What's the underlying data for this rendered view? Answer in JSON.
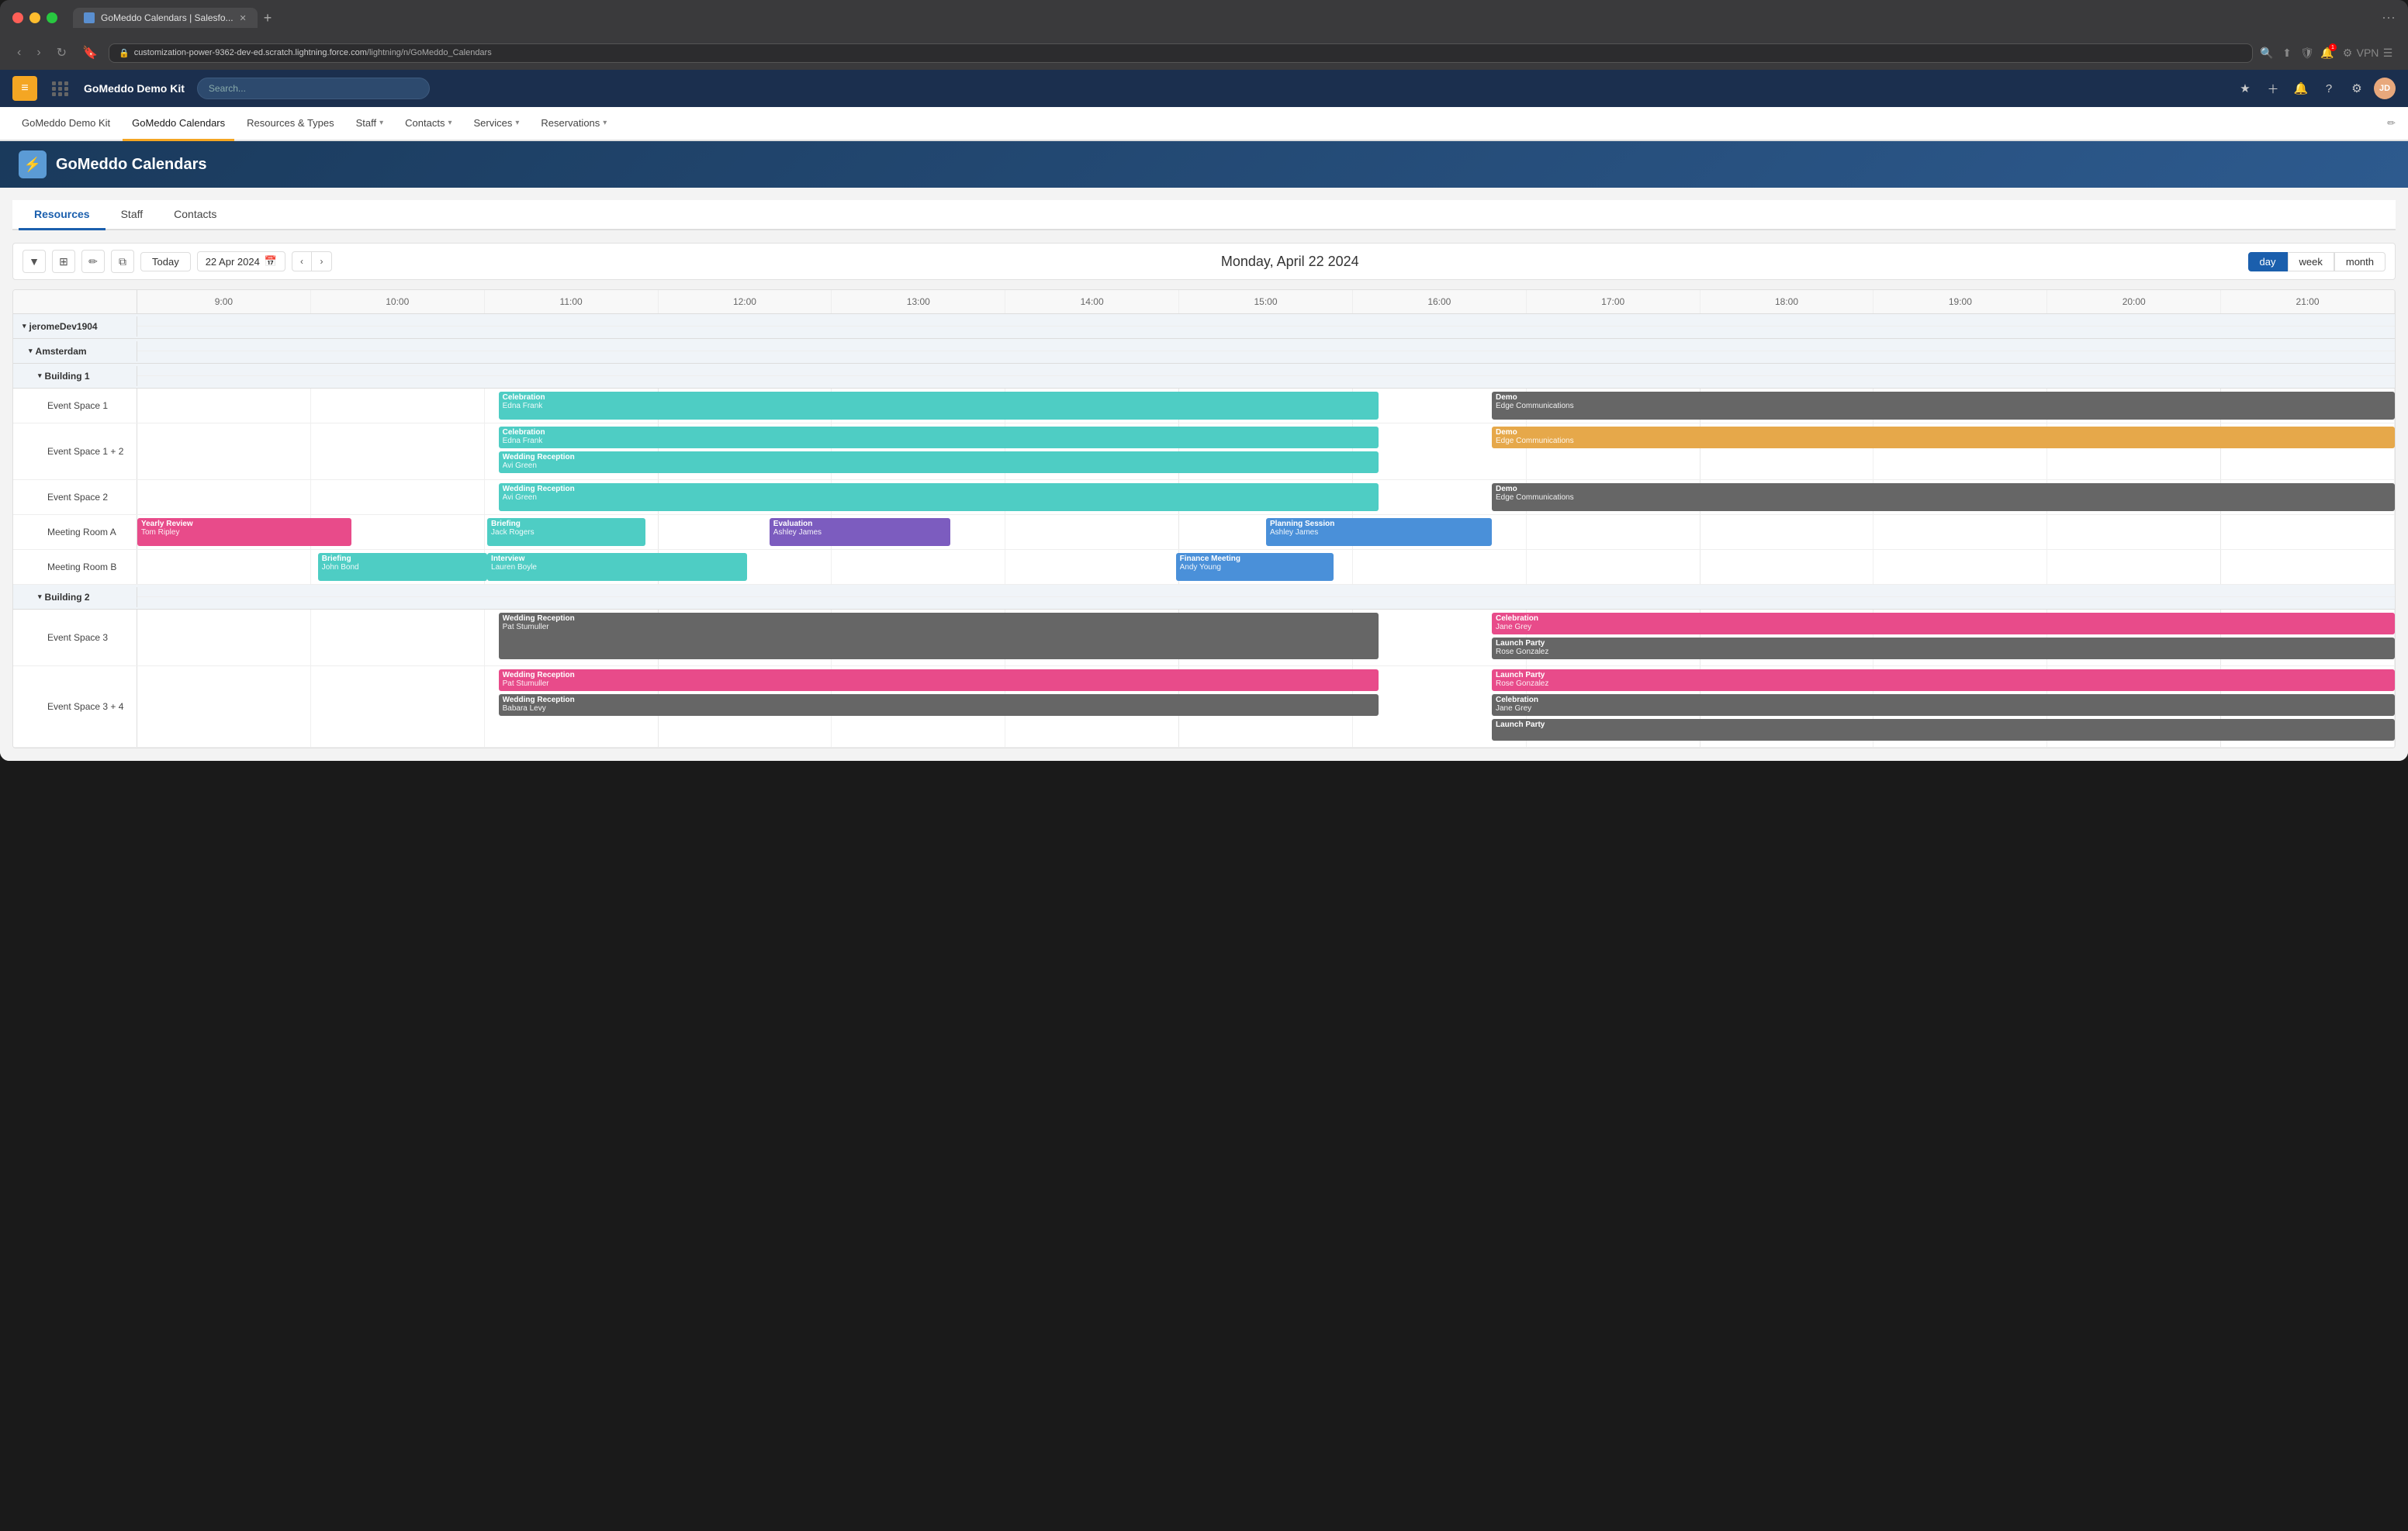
{
  "browser": {
    "tab_title": "GoMeddo Calendars | Salesfo...",
    "url_prefix": "customization-power-9362-dev-ed.scratch.lightning.force.com",
    "url_path": "/lightning/n/GoMeddo_Calendars",
    "new_tab_label": "+",
    "back_btn": "‹",
    "forward_btn": "›",
    "reload_btn": "↻"
  },
  "sf": {
    "app_name": "GoMeddo Demo Kit",
    "search_placeholder": "Search...",
    "nav_items": [
      {
        "label": "GoMeddo Demo Kit",
        "active": false
      },
      {
        "label": "GoMeddo Calendars",
        "active": true
      },
      {
        "label": "Resources & Types",
        "active": false
      },
      {
        "label": "Staff",
        "active": false,
        "dropdown": true
      },
      {
        "label": "Contacts",
        "active": false,
        "dropdown": true
      },
      {
        "label": "Services",
        "active": false,
        "dropdown": true
      },
      {
        "label": "Reservations",
        "active": false,
        "dropdown": true
      }
    ],
    "page_title": "GoMeddo Calendars"
  },
  "calendar": {
    "tabs": [
      "Resources",
      "Staff",
      "Contacts"
    ],
    "active_tab": "Resources",
    "today_label": "Today",
    "date_value": "22 Apr 2024",
    "center_date": "Monday, April 22 2024",
    "view_buttons": [
      "day",
      "week",
      "month"
    ],
    "active_view": "day",
    "time_slots": [
      "9:00",
      "10:00",
      "11:00",
      "12:00",
      "13:00",
      "14:00",
      "15:00",
      "16:00",
      "17:00",
      "18:00",
      "19:00",
      "20:00",
      "21:00"
    ],
    "groups": [
      {
        "name": "jeromeDev1904",
        "level": 0,
        "collapsed": false,
        "children": [
          {
            "name": "Amsterdam",
            "level": 1,
            "collapsed": false,
            "children": [
              {
                "name": "Building 1",
                "level": 2,
                "collapsed": false,
                "resources": [
                  {
                    "name": "Event Space 1",
                    "events": [
                      {
                        "title": "Celebration",
                        "sub": "Edna Frank",
                        "color": "teal",
                        "start_pct": 16.67,
                        "width_pct": 40,
                        "top_offset": 0
                      },
                      {
                        "title": "Demo",
                        "sub": "Edge Communications",
                        "color": "gray",
                        "start_pct": 59,
                        "width_pct": 41,
                        "top_offset": 0
                      }
                    ]
                  },
                  {
                    "name": "Event Space 1 + 2",
                    "events": [
                      {
                        "title": "Celebration",
                        "sub": "Edna Frank",
                        "color": "teal",
                        "start_pct": 16.67,
                        "width_pct": 40,
                        "row": 0
                      },
                      {
                        "title": "Demo",
                        "sub": "Edge Communications",
                        "color": "orange",
                        "start_pct": 59,
                        "width_pct": 41,
                        "row": 0
                      },
                      {
                        "title": "Wedding Reception",
                        "sub": "Avi Green",
                        "color": "teal",
                        "start_pct": 16.67,
                        "width_pct": 40,
                        "row": 1
                      }
                    ]
                  },
                  {
                    "name": "Event Space 2",
                    "events": [
                      {
                        "title": "Wedding Reception",
                        "sub": "Avi Green",
                        "color": "teal",
                        "start_pct": 16.67,
                        "width_pct": 40
                      },
                      {
                        "title": "Demo",
                        "sub": "Edge Communications",
                        "color": "gray",
                        "start_pct": 59,
                        "width_pct": 41
                      }
                    ]
                  },
                  {
                    "name": "Meeting Room A",
                    "events": [
                      {
                        "title": "Yearly Review",
                        "sub": "Tom Ripley",
                        "color": "pink",
                        "start_pct": 0,
                        "width_pct": 9
                      },
                      {
                        "title": "Briefing",
                        "sub": "Jack Rogers",
                        "color": "teal",
                        "start_pct": 16.67,
                        "width_pct": 7
                      },
                      {
                        "title": "Evaluation",
                        "sub": "Ashley James",
                        "color": "purple",
                        "start_pct": 28,
                        "width_pct": 8
                      },
                      {
                        "title": "Planning Session",
                        "sub": "Ashley James",
                        "color": "blue",
                        "start_pct": 50,
                        "width_pct": 9
                      }
                    ]
                  },
                  {
                    "name": "Meeting Room B",
                    "events": [
                      {
                        "title": "Briefing",
                        "sub": "John Bond",
                        "color": "teal",
                        "start_pct": 8.5,
                        "width_pct": 7
                      },
                      {
                        "title": "Interview",
                        "sub": "Lauren Boyle",
                        "color": "teal",
                        "start_pct": 15.5,
                        "width_pct": 9.5
                      },
                      {
                        "title": "Finance Meeting",
                        "sub": "Andy Young",
                        "color": "blue",
                        "start_pct": 45,
                        "width_pct": 6.5
                      }
                    ]
                  }
                ]
              },
              {
                "name": "Building 2",
                "level": 2,
                "collapsed": false,
                "resources": [
                  {
                    "name": "Event Space 3",
                    "events": [
                      {
                        "title": "Wedding Reception",
                        "sub": "Pat Stumuller",
                        "color": "gray",
                        "start_pct": 16.67,
                        "width_pct": 40
                      },
                      {
                        "title": "Celebration",
                        "sub": "Jane Grey",
                        "color": "pink",
                        "start_pct": 59,
                        "width_pct": 41,
                        "row": 0
                      },
                      {
                        "title": "Launch Party",
                        "sub": "Rose Gonzalez",
                        "color": "gray",
                        "start_pct": 59,
                        "width_pct": 41,
                        "row": 1
                      }
                    ]
                  },
                  {
                    "name": "Event Space 3 + 4",
                    "events": [
                      {
                        "title": "Wedding Reception",
                        "sub": "Pat Stumuller",
                        "color": "pink",
                        "start_pct": 16.67,
                        "width_pct": 40,
                        "row": 0
                      },
                      {
                        "title": "Launch Party",
                        "sub": "Rose Gonzalez",
                        "color": "pink",
                        "start_pct": 59,
                        "width_pct": 41,
                        "row": 0
                      },
                      {
                        "title": "Wedding Reception",
                        "sub": "Babara Levy",
                        "color": "gray",
                        "start_pct": 16.67,
                        "width_pct": 40,
                        "row": 1
                      },
                      {
                        "title": "Celebration",
                        "sub": "Jane Grey",
                        "color": "gray",
                        "start_pct": 59,
                        "width_pct": 41,
                        "row": 1
                      },
                      {
                        "title": "Launch Party",
                        "sub": "",
                        "color": "gray",
                        "start_pct": 59,
                        "width_pct": 41,
                        "row": 2
                      }
                    ]
                  }
                ]
              }
            ]
          }
        ]
      }
    ]
  }
}
